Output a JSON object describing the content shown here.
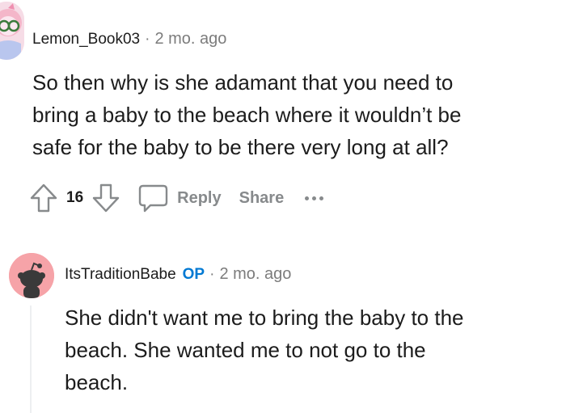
{
  "comments": [
    {
      "username": "Lemon_Book03",
      "separator": "·",
      "time": "2 mo. ago",
      "lines": [
        "So then why is she adamant that you need to",
        "bring a baby to the beach where it wouldn’t be",
        "safe for the baby to be there very long at all?"
      ],
      "actions": {
        "vote_count": "16",
        "reply_label": "Reply",
        "share_label": "Share"
      }
    },
    {
      "username": "ItsTraditionBabe",
      "op_badge": "OP",
      "separator": "·",
      "time": "2 mo. ago",
      "lines": [
        "She didn't want me to bring the baby to the",
        "beach. She wanted me to not go to the",
        "beach."
      ]
    }
  ],
  "colors": {
    "text": "#1c1c1c",
    "meta": "#7c7c7c",
    "action": "#878a8c",
    "op_badge": "#0079d3",
    "avatar_2_bg": "#f6a3a8"
  },
  "icons": {
    "upvote": "upvote-arrow-icon",
    "downvote": "downvote-arrow-icon",
    "reply": "speech-bubble-icon",
    "more": "more-dots-icon"
  }
}
